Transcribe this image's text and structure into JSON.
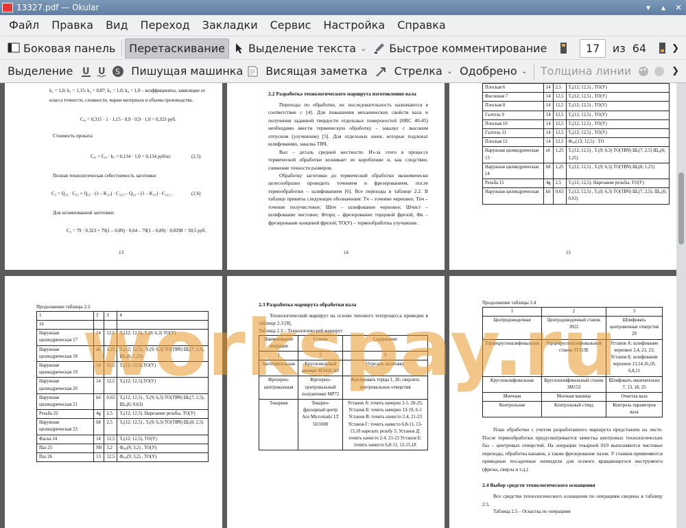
{
  "window": {
    "title": "13327.pdf — Okular"
  },
  "menu": [
    "Файл",
    "Правка",
    "Вид",
    "Переход",
    "Закладки",
    "Сервис",
    "Настройка",
    "Справка"
  ],
  "toolbar1": {
    "sidebar": "Боковая панель",
    "drag": "Перетаскивание",
    "text_select": "Выделение текста",
    "quick_comment": "Быстрое комментирование",
    "page_current": "17",
    "page_of": "из",
    "page_total": "64"
  },
  "toolbar2": {
    "select": "Выделение",
    "typewriter": "Пишущая машинка",
    "note": "Висящая заметка",
    "arrow": "Стрелка",
    "approved": "Одобрено",
    "line_width": "Толщина линии"
  },
  "watermark": "workspay.ru",
  "p13": {
    "coef": "k₁ = 1,0; k₁ = 1,15; k₂ = 0,87; k₃ = 1,0; k₄ = 1,0 – коэффициенты, зависящие от",
    "coef2": "класса точности, сложности, марки материала и объема производства.",
    "f1": "Cₑₑ = 0,315 · 1 · 1,15 · 0,9 · 0,9 · 1,0 = 0,323 руб.",
    "cost": "Стоимость проката:",
    "f2": "Cₑₑ = Cₑₑ · kₑ = 0,134 · 1,0 = 0,134 руб/кг.",
    "f2n": "(2.5)",
    "full": "Полная технологическая себестоимость заготовки:",
    "f3": "C₃ = Q₃₃ · C₃₃ + Q₃₃ · (1 – K₃₃) · C₃₃₃ – Q₃₃ – (1 – K₃₃) · C₃₃₃ .",
    "f3n": "(2.6)",
    "stamp": "Для штампованной заготовки:",
    "f4": "C₃ = 79 · 0,323 + 79(1 – 0,89) · 0,64 – 79(1 – 0,89) · 0,0298 = 30,5 руб.",
    "num": "13"
  },
  "p14": {
    "heading": "2.2 Разработка технологического маршрута изготовления вала",
    "para1": "Переходы по обработке, их последовательность назначаются в соответствие с [4]. Для повышения механических свойств вала и получения заданной твердости отдельных поверхностей (HRC 40-45) необходимо ввести термическую обработку – закалку с высоким отпуском (улучшение) [5]. Для отдельных шеек, которые подлежат шлифованию, закалка ТВЧ.",
    "para2": "Вал – деталь средней жесткости. Из-за этого в процессе термической обработки возникает ее коробление и, как следствие, снижение точности размеров.",
    "para3": "Обработку заготовки до термической обработки экономически целесообразно проводить точением и фрезерованием, после термообработки – шлифованием [6]. Все переходы в таблице 2.2. В таблице приняты следующие обозначения: Тч – точение черновое; Тпч – точение получистовое; Шпч – шлифование черновое; Шчист – шлифование чистовое; Фторц – фрезерование торцовой фрезой; Фк – фрезерование концевой фрезой; ТО(У) – термообработка улучшение.",
    "num": "14"
  },
  "p15": {
    "rows": [
      [
        "Плоская 6",
        "14",
        "2,5",
        "Тₐ(12; 12,5) , ТО(У)"
      ],
      [
        "Фасонная 7",
        "14",
        "12,5",
        "Тₐ(12; 12,5) , ТО(У)"
      ],
      [
        "Плоская 8",
        "14",
        "12,5",
        "Тₐ(12; 12,5) , ТО(У)"
      ],
      [
        "Галтель 9",
        "14",
        "12,5",
        "Тₐ(12; 12,5) , ТО(У)"
      ],
      [
        "Плоская 10",
        "14",
        "12,5",
        "Тₐ(12; 12,5) , ТО(У)"
      ],
      [
        "Галтель 11",
        "14",
        "12,5",
        "Тₐ(12; 12,5) , ТО(У)"
      ],
      [
        "Плоская 12",
        "14",
        "12,5",
        "Фₑₑₑ(13; 12,5) · ТО"
      ],
      [
        "Наружная цилиндрическая 13",
        "s6",
        "1,25",
        "Тₐ(12; 12,5) , Тₑ(9; 6,3) ТО(ТВЧ) Шₑ(7; 2,5) Шₑₑ(6; 1,25)"
      ],
      [
        "Наружная цилиндрическая 14",
        "h8",
        "1,25",
        "Тₐ(12; 12,5) , Тₑ(9; 6,3) ТО(ТВЧ) Шₑ(8; 1,25)"
      ],
      [
        "Резьба 15",
        "4g",
        "2,5",
        "Тₐ(12; 12,5), Нарезание резьбы, ТО(У)"
      ],
      [
        "Наружная цилиндрическая",
        "k6",
        "0,63",
        "Тₐ(12; 12,5) , Тₑ(9; 6,3) ТО(ТВЧ) Шₑ(7; 2,5), Шₑₑ(6; 0,63)"
      ]
    ],
    "num": "15"
  },
  "p16": {
    "caption": "Продолжение таблицы 2.2",
    "head": [
      "1",
      "2",
      "3",
      "4"
    ],
    "rows": [
      [
        "16",
        "",
        "",
        ""
      ],
      [
        "Наружная цилиндрическая 17",
        "14",
        "12,5",
        "Тₐ(12; 12,5), Тₑ(9; 6,3) ТО(У)"
      ],
      [
        "Наружная цилиндрическая 18",
        "s6",
        "1,25",
        "Тₐ(12; 12,5) , Тₑ(9; 6,3) ТО(ТВЧ) Шₑ(7; 2,5), Шₑₑ(6; 1,25)"
      ],
      [
        "Наружная цилиндрическая 19",
        "14",
        "12,5",
        "Тₐ(12; 12,5),ТО(У)"
      ],
      [
        "Наружная цилиндрическая 20",
        "14",
        "12,5",
        "Тₐ(12; 12,5),ТО(У)"
      ],
      [
        "Наружная цилиндрическая 21",
        "k6",
        "0,63",
        "Тₐ(12; 12,5) , Тₑ(9; 6,3) ТО(ТВЧ) Шₑ(7; 2,5), Шₑₑ(6; 0,63)"
      ],
      [
        "Резьба 22",
        "4g",
        "2,5",
        "Тₐ(12; 12,5). Нарезание резьбы, ТО(У)"
      ],
      [
        "Наружная цилиндрическая 23",
        "h8",
        "2,5",
        "Тₐ(12; 12,5) , Тₑ(9; 6,3) ТО(ТВЧ) Шₑ(8; 2,5)"
      ],
      [
        "Фаска 24",
        "14",
        "12,5",
        "Тₐ(12; 12,5), ТО(У)"
      ],
      [
        "Паз 25",
        "N9",
        "3,2",
        "Фₑₑₑ(9; 3,2) , ТО(У)"
      ],
      [
        "Паз 26",
        "13",
        "12,5",
        "Фₑₑₑ(9; 3,2) , ТО(У)"
      ]
    ]
  },
  "p17": {
    "heading": "2.3 Разработка маршрута обработки вала",
    "para": "Технологический маршрут на основе типового техпроцесса приведен в таблице 2.3 [8].",
    "caption": "Таблица 2.3 – Технологический маршрут",
    "head": [
      "Наименование операции",
      "Станок",
      "Содержание"
    ],
    "nums": [
      "1",
      "2",
      "3"
    ],
    "rows": [
      [
        "Заготовительная",
        "Круглопильный автомат 8Г662САУ",
        "Отрезать заготовку"
      ],
      [
        "Фрезерно-центровальная",
        "Фрезерно-центровальный полуавтомат МР72",
        "Фрезеровать торцы 1, 26; сверлить центровальные отверстия"
      ],
      [
        "Токарная",
        "Токарно-фрезерный центр Ace Micromatic LT 50/1000",
        "Установ А: точить начерно 2-5, 20-25; Установ Б: точить начерно 13-19, 6-1 Установ В: точить начисто 2-4, 21-23 Установ Г: точить начисто 6,8-11, 13-15,18 нарезать резьбу 5; Установ Д: точить начисто 2-4, 21-23 Установ Е: точить начисто 6,8-11, 13-15,18"
      ]
    ]
  },
  "p18": {
    "caption": "Продолжение таблицы 2.4",
    "head": [
      "1",
      "2",
      "3"
    ],
    "rows": [
      [
        "Центродоводочная",
        "Центродоводочный станок 3922",
        "Шлифовать центровочные отверстия 29"
      ],
      [
        "Торцекруглошлифовальная",
        "Торцекруглошлифовальный станок 3Т153Е",
        "Установ А: шлифование черновое 2,4, 21, 23; Установ Б: шлифование черновое 13,14,16,18, 6,8,11"
      ],
      [
        "Круглошлифовальная",
        "Круглошлифовальный станок 3М153",
        "Шлифовать окончательно 7, 13, 18, 25"
      ],
      [
        "Моечная",
        "Моечная машина",
        "Очистка вала"
      ],
      [
        "Контрольная",
        "Контрольный стенд",
        "Контроль параметров вала"
      ]
    ],
    "para1": "План обработки с учетом разработанного маршрута представлен на листе. После термообработки предусматривается зачистка центровых технологических баз – центровых отверстий. На операции токарной 010 выполняются чистовые переходы, обработка канавок, а также фрезерование пазов. У станков применяются приводные посадочные шпиндели для осевого вращающегося инструмента (фрезы, сверла и т.д.)",
    "heading": "2.4 Выбор средств технологического оснащения",
    "para2": "Все средства технологического оснащения по операциям сведены в таблицу 2.5.",
    "caption2": "Таблица 2.5 – Оснастка по операциям",
    "tail": "Режущий"
  }
}
